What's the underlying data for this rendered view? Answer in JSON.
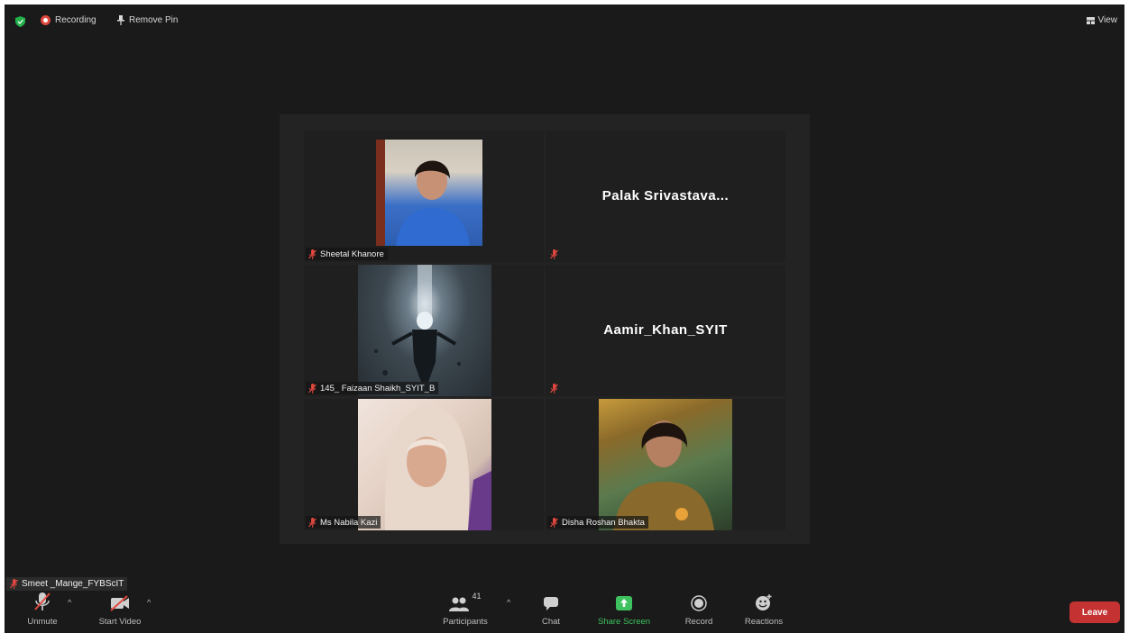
{
  "topbar": {
    "recording_label": "Recording",
    "remove_pin_label": "Remove Pin",
    "view_label": "View"
  },
  "participants_grid": [
    {
      "name": "Sheetal Khanore",
      "has_video": true
    },
    {
      "name": "Palak Srivastava...",
      "has_video": false
    },
    {
      "name": "145_ Faizaan Shaikh_SYIT_B",
      "has_video": true
    },
    {
      "name": "Aamir_Khan_SYIT",
      "has_video": false
    },
    {
      "name": "Ms Nabila Kazi",
      "has_video": true
    },
    {
      "name": "Disha Roshan Bhakta",
      "has_video": true
    }
  ],
  "self_view": {
    "name": "Smeet _Mange_FYBScIT"
  },
  "toolbar": {
    "unmute_label": "Unmute",
    "start_video_label": "Start Video",
    "participants_label": "Participants",
    "participants_count": "41",
    "chat_label": "Chat",
    "share_screen_label": "Share Screen",
    "record_label": "Record",
    "reactions_label": "Reactions",
    "leave_label": "Leave"
  },
  "colors": {
    "background": "#1a1a1a",
    "leave_red": "#c53232",
    "share_green": "#3ec25f",
    "mute_red": "#e0483e"
  }
}
